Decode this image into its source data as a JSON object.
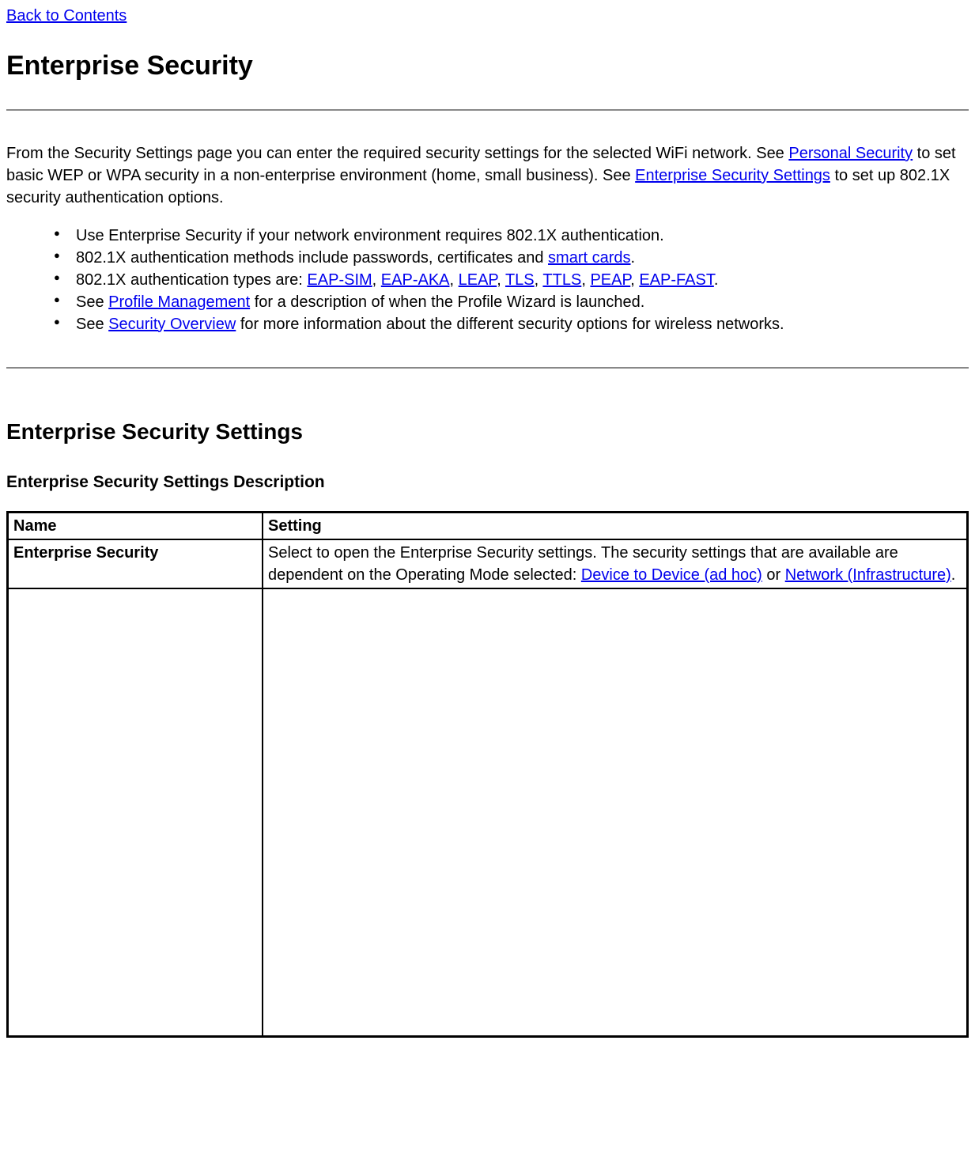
{
  "nav": {
    "back_to_contents": "Back to Contents"
  },
  "headings": {
    "h1": "Enterprise Security",
    "h2": "Enterprise Security Settings",
    "h3": "Enterprise Security Settings Description"
  },
  "intro": {
    "part1": "From the Security Settings page you can enter the required security settings for the selected WiFi network. See ",
    "link_personal_security": "Personal Security",
    "part2": " to set basic WEP or WPA security in a non-enterprise environment (home, small business). See ",
    "link_enterprise_security_settings": "Enterprise Security Settings",
    "part3": " to set up 802.1X security authentication options."
  },
  "bullets": {
    "b1": "Use Enterprise Security if your network environment requires 802.1X authentication.",
    "b2_part1": "802.1X authentication methods include passwords, certificates and ",
    "b2_link_smart_cards": "smart cards",
    "b2_part2": ".",
    "b3_part1": "802.1X authentication types are: ",
    "b3_link_eap_sim": "EAP-SIM",
    "b3_sep1": ", ",
    "b3_link_eap_aka": "EAP-AKA",
    "b3_sep2": ", ",
    "b3_link_leap": "LEAP",
    "b3_sep3": ", ",
    "b3_link_tls": "TLS",
    "b3_sep4": ", ",
    "b3_link_ttls": "TTLS",
    "b3_sep5": ", ",
    "b3_link_peap": "PEAP",
    "b3_sep6": ", ",
    "b3_link_eap_fast": "EAP-FAST",
    "b3_part2": ".",
    "b4_part1": "See ",
    "b4_link_profile_management": "Profile Management",
    "b4_part2": " for a description of when the Profile Wizard is launched.",
    "b5_part1": "See ",
    "b5_link_security_overview": "Security Overview",
    "b5_part2": " for more information about the different security options for wireless networks."
  },
  "table": {
    "header_name": "Name",
    "header_setting": "Setting",
    "row1_name": "Enterprise Security",
    "row1_setting_part1": "Select to open the Enterprise Security settings. The security settings that are available are dependent on the Operating Mode selected: ",
    "row1_link_device_to_device": "Device to Device (ad hoc)",
    "row1_setting_or": " or ",
    "row1_link_network_infrastructure": "Network (Infrastructure)",
    "row1_setting_end": "."
  }
}
